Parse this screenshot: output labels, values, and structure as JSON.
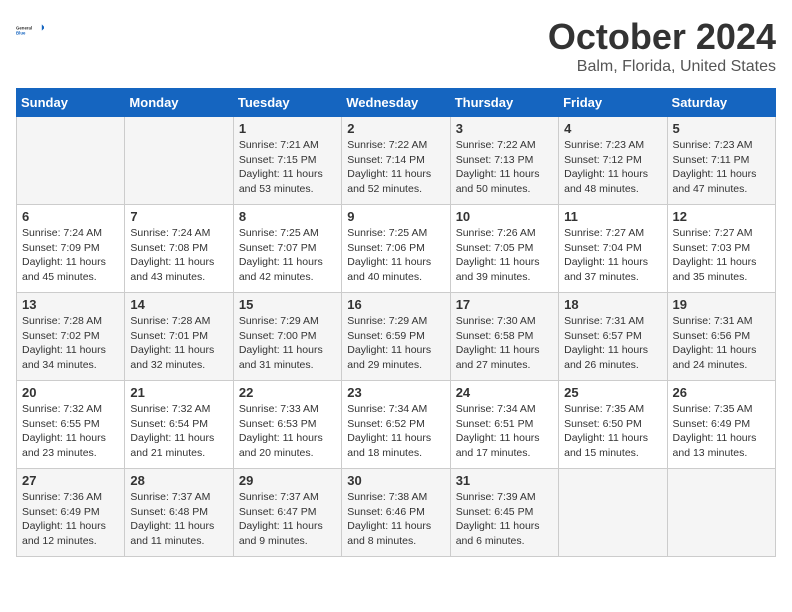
{
  "header": {
    "logo_general": "General",
    "logo_blue": "Blue",
    "month": "October 2024",
    "location": "Balm, Florida, United States"
  },
  "days_of_week": [
    "Sunday",
    "Monday",
    "Tuesday",
    "Wednesday",
    "Thursday",
    "Friday",
    "Saturday"
  ],
  "weeks": [
    [
      {
        "day": "",
        "content": ""
      },
      {
        "day": "",
        "content": ""
      },
      {
        "day": "1",
        "content": "Sunrise: 7:21 AM\nSunset: 7:15 PM\nDaylight: 11 hours and 53 minutes."
      },
      {
        "day": "2",
        "content": "Sunrise: 7:22 AM\nSunset: 7:14 PM\nDaylight: 11 hours and 52 minutes."
      },
      {
        "day": "3",
        "content": "Sunrise: 7:22 AM\nSunset: 7:13 PM\nDaylight: 11 hours and 50 minutes."
      },
      {
        "day": "4",
        "content": "Sunrise: 7:23 AM\nSunset: 7:12 PM\nDaylight: 11 hours and 48 minutes."
      },
      {
        "day": "5",
        "content": "Sunrise: 7:23 AM\nSunset: 7:11 PM\nDaylight: 11 hours and 47 minutes."
      }
    ],
    [
      {
        "day": "6",
        "content": "Sunrise: 7:24 AM\nSunset: 7:09 PM\nDaylight: 11 hours and 45 minutes."
      },
      {
        "day": "7",
        "content": "Sunrise: 7:24 AM\nSunset: 7:08 PM\nDaylight: 11 hours and 43 minutes."
      },
      {
        "day": "8",
        "content": "Sunrise: 7:25 AM\nSunset: 7:07 PM\nDaylight: 11 hours and 42 minutes."
      },
      {
        "day": "9",
        "content": "Sunrise: 7:25 AM\nSunset: 7:06 PM\nDaylight: 11 hours and 40 minutes."
      },
      {
        "day": "10",
        "content": "Sunrise: 7:26 AM\nSunset: 7:05 PM\nDaylight: 11 hours and 39 minutes."
      },
      {
        "day": "11",
        "content": "Sunrise: 7:27 AM\nSunset: 7:04 PM\nDaylight: 11 hours and 37 minutes."
      },
      {
        "day": "12",
        "content": "Sunrise: 7:27 AM\nSunset: 7:03 PM\nDaylight: 11 hours and 35 minutes."
      }
    ],
    [
      {
        "day": "13",
        "content": "Sunrise: 7:28 AM\nSunset: 7:02 PM\nDaylight: 11 hours and 34 minutes."
      },
      {
        "day": "14",
        "content": "Sunrise: 7:28 AM\nSunset: 7:01 PM\nDaylight: 11 hours and 32 minutes."
      },
      {
        "day": "15",
        "content": "Sunrise: 7:29 AM\nSunset: 7:00 PM\nDaylight: 11 hours and 31 minutes."
      },
      {
        "day": "16",
        "content": "Sunrise: 7:29 AM\nSunset: 6:59 PM\nDaylight: 11 hours and 29 minutes."
      },
      {
        "day": "17",
        "content": "Sunrise: 7:30 AM\nSunset: 6:58 PM\nDaylight: 11 hours and 27 minutes."
      },
      {
        "day": "18",
        "content": "Sunrise: 7:31 AM\nSunset: 6:57 PM\nDaylight: 11 hours and 26 minutes."
      },
      {
        "day": "19",
        "content": "Sunrise: 7:31 AM\nSunset: 6:56 PM\nDaylight: 11 hours and 24 minutes."
      }
    ],
    [
      {
        "day": "20",
        "content": "Sunrise: 7:32 AM\nSunset: 6:55 PM\nDaylight: 11 hours and 23 minutes."
      },
      {
        "day": "21",
        "content": "Sunrise: 7:32 AM\nSunset: 6:54 PM\nDaylight: 11 hours and 21 minutes."
      },
      {
        "day": "22",
        "content": "Sunrise: 7:33 AM\nSunset: 6:53 PM\nDaylight: 11 hours and 20 minutes."
      },
      {
        "day": "23",
        "content": "Sunrise: 7:34 AM\nSunset: 6:52 PM\nDaylight: 11 hours and 18 minutes."
      },
      {
        "day": "24",
        "content": "Sunrise: 7:34 AM\nSunset: 6:51 PM\nDaylight: 11 hours and 17 minutes."
      },
      {
        "day": "25",
        "content": "Sunrise: 7:35 AM\nSunset: 6:50 PM\nDaylight: 11 hours and 15 minutes."
      },
      {
        "day": "26",
        "content": "Sunrise: 7:35 AM\nSunset: 6:49 PM\nDaylight: 11 hours and 13 minutes."
      }
    ],
    [
      {
        "day": "27",
        "content": "Sunrise: 7:36 AM\nSunset: 6:49 PM\nDaylight: 11 hours and 12 minutes."
      },
      {
        "day": "28",
        "content": "Sunrise: 7:37 AM\nSunset: 6:48 PM\nDaylight: 11 hours and 11 minutes."
      },
      {
        "day": "29",
        "content": "Sunrise: 7:37 AM\nSunset: 6:47 PM\nDaylight: 11 hours and 9 minutes."
      },
      {
        "day": "30",
        "content": "Sunrise: 7:38 AM\nSunset: 6:46 PM\nDaylight: 11 hours and 8 minutes."
      },
      {
        "day": "31",
        "content": "Sunrise: 7:39 AM\nSunset: 6:45 PM\nDaylight: 11 hours and 6 minutes."
      },
      {
        "day": "",
        "content": ""
      },
      {
        "day": "",
        "content": ""
      }
    ]
  ]
}
